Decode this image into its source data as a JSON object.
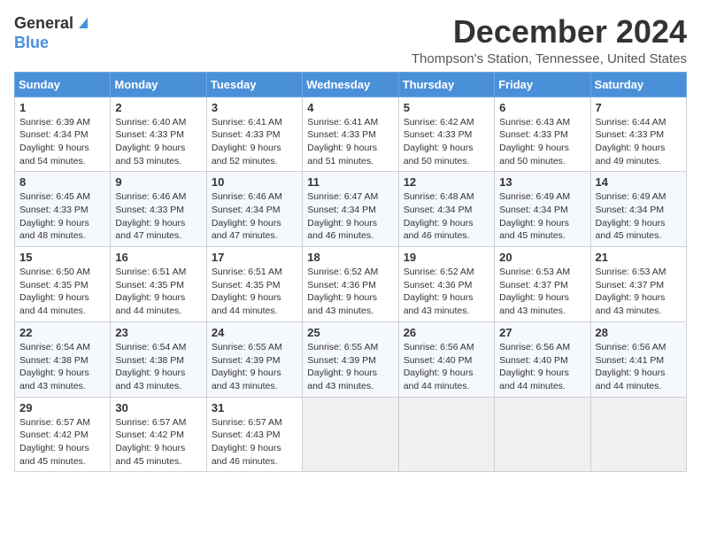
{
  "header": {
    "logo_general": "General",
    "logo_blue": "Blue",
    "month_title": "December 2024",
    "location": "Thompson's Station, Tennessee, United States"
  },
  "days_of_week": [
    "Sunday",
    "Monday",
    "Tuesday",
    "Wednesday",
    "Thursday",
    "Friday",
    "Saturday"
  ],
  "weeks": [
    [
      {
        "day": "1",
        "sunrise": "6:39 AM",
        "sunset": "4:34 PM",
        "daylight": "9 hours and 54 minutes."
      },
      {
        "day": "2",
        "sunrise": "6:40 AM",
        "sunset": "4:33 PM",
        "daylight": "9 hours and 53 minutes."
      },
      {
        "day": "3",
        "sunrise": "6:41 AM",
        "sunset": "4:33 PM",
        "daylight": "9 hours and 52 minutes."
      },
      {
        "day": "4",
        "sunrise": "6:41 AM",
        "sunset": "4:33 PM",
        "daylight": "9 hours and 51 minutes."
      },
      {
        "day": "5",
        "sunrise": "6:42 AM",
        "sunset": "4:33 PM",
        "daylight": "9 hours and 50 minutes."
      },
      {
        "day": "6",
        "sunrise": "6:43 AM",
        "sunset": "4:33 PM",
        "daylight": "9 hours and 50 minutes."
      },
      {
        "day": "7",
        "sunrise": "6:44 AM",
        "sunset": "4:33 PM",
        "daylight": "9 hours and 49 minutes."
      }
    ],
    [
      {
        "day": "8",
        "sunrise": "6:45 AM",
        "sunset": "4:33 PM",
        "daylight": "9 hours and 48 minutes."
      },
      {
        "day": "9",
        "sunrise": "6:46 AM",
        "sunset": "4:33 PM",
        "daylight": "9 hours and 47 minutes."
      },
      {
        "day": "10",
        "sunrise": "6:46 AM",
        "sunset": "4:34 PM",
        "daylight": "9 hours and 47 minutes."
      },
      {
        "day": "11",
        "sunrise": "6:47 AM",
        "sunset": "4:34 PM",
        "daylight": "9 hours and 46 minutes."
      },
      {
        "day": "12",
        "sunrise": "6:48 AM",
        "sunset": "4:34 PM",
        "daylight": "9 hours and 46 minutes."
      },
      {
        "day": "13",
        "sunrise": "6:49 AM",
        "sunset": "4:34 PM",
        "daylight": "9 hours and 45 minutes."
      },
      {
        "day": "14",
        "sunrise": "6:49 AM",
        "sunset": "4:34 PM",
        "daylight": "9 hours and 45 minutes."
      }
    ],
    [
      {
        "day": "15",
        "sunrise": "6:50 AM",
        "sunset": "4:35 PM",
        "daylight": "9 hours and 44 minutes."
      },
      {
        "day": "16",
        "sunrise": "6:51 AM",
        "sunset": "4:35 PM",
        "daylight": "9 hours and 44 minutes."
      },
      {
        "day": "17",
        "sunrise": "6:51 AM",
        "sunset": "4:35 PM",
        "daylight": "9 hours and 44 minutes."
      },
      {
        "day": "18",
        "sunrise": "6:52 AM",
        "sunset": "4:36 PM",
        "daylight": "9 hours and 43 minutes."
      },
      {
        "day": "19",
        "sunrise": "6:52 AM",
        "sunset": "4:36 PM",
        "daylight": "9 hours and 43 minutes."
      },
      {
        "day": "20",
        "sunrise": "6:53 AM",
        "sunset": "4:37 PM",
        "daylight": "9 hours and 43 minutes."
      },
      {
        "day": "21",
        "sunrise": "6:53 AM",
        "sunset": "4:37 PM",
        "daylight": "9 hours and 43 minutes."
      }
    ],
    [
      {
        "day": "22",
        "sunrise": "6:54 AM",
        "sunset": "4:38 PM",
        "daylight": "9 hours and 43 minutes."
      },
      {
        "day": "23",
        "sunrise": "6:54 AM",
        "sunset": "4:38 PM",
        "daylight": "9 hours and 43 minutes."
      },
      {
        "day": "24",
        "sunrise": "6:55 AM",
        "sunset": "4:39 PM",
        "daylight": "9 hours and 43 minutes."
      },
      {
        "day": "25",
        "sunrise": "6:55 AM",
        "sunset": "4:39 PM",
        "daylight": "9 hours and 43 minutes."
      },
      {
        "day": "26",
        "sunrise": "6:56 AM",
        "sunset": "4:40 PM",
        "daylight": "9 hours and 44 minutes."
      },
      {
        "day": "27",
        "sunrise": "6:56 AM",
        "sunset": "4:40 PM",
        "daylight": "9 hours and 44 minutes."
      },
      {
        "day": "28",
        "sunrise": "6:56 AM",
        "sunset": "4:41 PM",
        "daylight": "9 hours and 44 minutes."
      }
    ],
    [
      {
        "day": "29",
        "sunrise": "6:57 AM",
        "sunset": "4:42 PM",
        "daylight": "9 hours and 45 minutes."
      },
      {
        "day": "30",
        "sunrise": "6:57 AM",
        "sunset": "4:42 PM",
        "daylight": "9 hours and 45 minutes."
      },
      {
        "day": "31",
        "sunrise": "6:57 AM",
        "sunset": "4:43 PM",
        "daylight": "9 hours and 46 minutes."
      },
      null,
      null,
      null,
      null
    ]
  ],
  "labels": {
    "sunrise": "Sunrise:",
    "sunset": "Sunset:",
    "daylight": "Daylight:"
  }
}
